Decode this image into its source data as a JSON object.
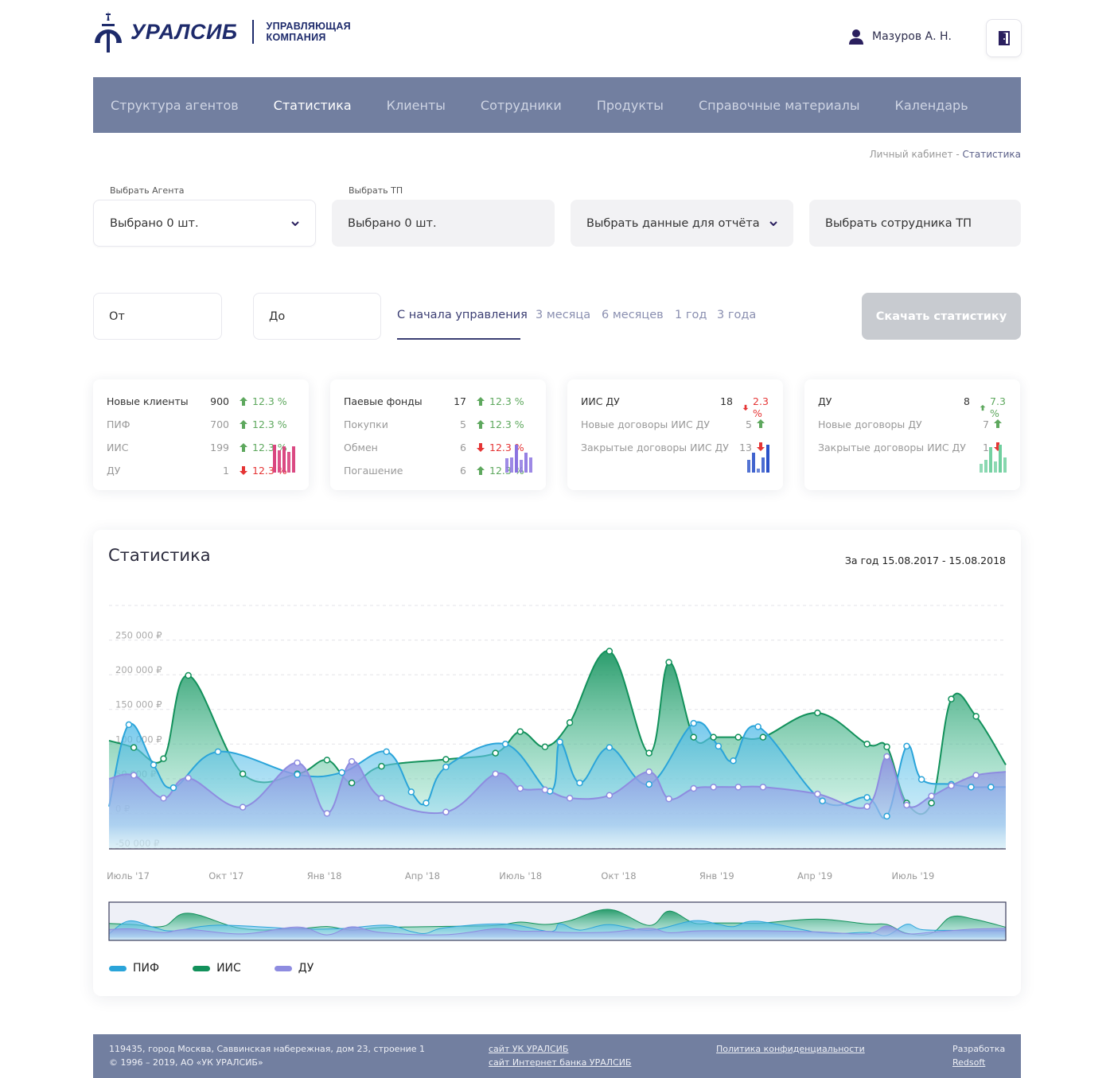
{
  "header": {
    "logo_name": "УРАЛСИБ",
    "logo_sub_line1": "УПРАВЛЯЮЩАЯ",
    "logo_sub_line2": "КОМПАНИЯ",
    "user_name": "Мазуров А. Н.",
    "user_icon": "user-icon",
    "logout_icon": "logout-door-icon",
    "brand_color": "#1d2a6b"
  },
  "nav": {
    "bg_color": "#727fa0",
    "items": [
      {
        "label": "Структура агентов"
      },
      {
        "label": "Статистика",
        "active": true
      },
      {
        "label": "Клиенты"
      },
      {
        "label": "Сотрудники"
      },
      {
        "label": "Продукты"
      },
      {
        "label": "Справочные материалы"
      },
      {
        "label": "Календарь"
      }
    ]
  },
  "breadcrumb": {
    "parent": "Личный кабинет",
    "separator": " - ",
    "current": "Статистика"
  },
  "filters": {
    "agent": {
      "label": "Выбрать Агента",
      "value": "Выбрано 0 шт."
    },
    "tp": {
      "label": "Выбрать ТП",
      "value": "Выбрано 0 шт."
    },
    "report": {
      "value": "Выбрать данные для отчёта"
    },
    "employee": {
      "value": "Выбрать сотрудника ТП"
    },
    "date_from": {
      "placeholder": "От"
    },
    "date_to": {
      "placeholder": "До"
    },
    "periods": [
      "С начала управления",
      "3 месяца",
      "6 месяцев",
      "1 год",
      "3 года"
    ],
    "active_period": 0,
    "download_label": "Скачать статистику"
  },
  "cards": [
    {
      "title": "Новые клиенты",
      "value": "900",
      "pct": "12.3 %",
      "dir": "up",
      "rows": [
        {
          "label": "ПИФ",
          "value": "700",
          "pct": "12.3 %",
          "dir": "up"
        },
        {
          "label": "ИИС",
          "value": "199",
          "pct": "12.3 %",
          "dir": "up"
        },
        {
          "label": "ДУ",
          "value": "1",
          "pct": "12.3 %",
          "dir": "down"
        }
      ],
      "bar_color": "#d9457f",
      "bars": [
        1.0,
        0.8,
        0.95,
        0.75,
        0.95
      ]
    },
    {
      "title": "Паевые фонды",
      "value": "17",
      "pct": "12.3 %",
      "dir": "up",
      "rows": [
        {
          "label": "Покупки",
          "value": "5",
          "pct": "12.3 %",
          "dir": "up"
        },
        {
          "label": "Обмен",
          "value": "6",
          "pct": "12.3 %",
          "dir": "down"
        },
        {
          "label": "Погашение",
          "value": "6",
          "pct": "12.3 %",
          "dir": "up"
        }
      ],
      "bar_color": "#8a72e0",
      "bars": [
        0.5,
        0.55,
        1.0,
        0.45,
        0.7,
        0.55
      ]
    },
    {
      "title": "ИИС ДУ",
      "value": "18",
      "pct": "2.3 %",
      "dir": "down",
      "rows": [
        {
          "label": "Новые договоры ИИС ДУ",
          "value": "5",
          "pct": "",
          "dir": "up"
        },
        {
          "label": "Закрытые договоры ИИС ДУ",
          "value": "13",
          "pct": "",
          "dir": "down"
        }
      ],
      "bar_color": "#2b52c9",
      "bars": [
        0.45,
        0.7,
        0.15,
        0.55,
        1.0
      ]
    },
    {
      "title": "ДУ",
      "value": "8",
      "pct": "7.3 %",
      "dir": "up",
      "rows": [
        {
          "label": "Новые договоры ДУ",
          "value": "7",
          "pct": "",
          "dir": "up"
        },
        {
          "label": "Закрытые договоры ИИС ДУ",
          "value": "1",
          "pct": "",
          "dir": "down"
        }
      ],
      "bar_color": "#6fcf9f",
      "bars": [
        0.3,
        0.45,
        0.9,
        0.4,
        1.0,
        0.55
      ]
    }
  ],
  "chart_data": {
    "type": "area",
    "title": "Статистика",
    "subtitle": "За год 15.08.2017 - 15.08.2018",
    "y_ticks": [
      "250 000 ₽",
      "200 000 ₽",
      "150 000 ₽",
      "100 000 ₽",
      "50 000 ₽",
      "0 ₽",
      "-50 000 ₽"
    ],
    "x_ticks": [
      "Июль '17",
      "Окт '17",
      "Янв '18",
      "Апр '18",
      "Июль '18",
      "Окт '18",
      "Янв '19",
      "Апр '19",
      "Июль '19"
    ],
    "ylim": [
      -50000,
      300000
    ],
    "grid": true,
    "legend_position": "bottom-left",
    "series": [
      {
        "name": "ПИФ",
        "color": "#2aa4d9",
        "x": [
          0,
          0.4,
          0.9,
          1.3,
          2.2,
          3.8,
          4.7,
          5.6,
          6.1,
          6.4,
          6.8,
          8.0,
          8.9,
          9.1,
          9.5,
          10.1,
          10.9,
          11.8,
          12.3,
          12.6,
          13.1,
          14.4,
          15.3,
          15.7,
          16.1,
          16.4,
          17.0,
          17.4,
          17.8,
          18.1
        ],
        "y": [
          10000,
          128000,
          70000,
          37000,
          89000,
          56000,
          59000,
          89000,
          31000,
          15000,
          67000,
          100000,
          32000,
          103000,
          44000,
          95000,
          42000,
          130000,
          97000,
          76000,
          125000,
          18000,
          23000,
          -4000,
          97000,
          49000,
          42000,
          38000,
          38000,
          38000
        ]
      },
      {
        "name": "ИИС",
        "color": "#12915b",
        "x": [
          0,
          0.5,
          1.1,
          1.6,
          2.7,
          3.8,
          4.4,
          4.9,
          5.5,
          6.8,
          7.8,
          8.3,
          8.8,
          9.3,
          10.1,
          10.9,
          11.3,
          11.8,
          12.2,
          12.7,
          13.2,
          14.3,
          15.3,
          15.7,
          16.1,
          16.6,
          17.0,
          17.5,
          18.1
        ],
        "y": [
          105000,
          95000,
          79000,
          199000,
          57000,
          57000,
          77000,
          44000,
          68000,
          78000,
          87000,
          118000,
          96000,
          131000,
          234000,
          87000,
          218000,
          110000,
          110000,
          110000,
          110000,
          145000,
          100000,
          96000,
          15000,
          15000,
          165000,
          140000,
          70000
        ]
      },
      {
        "name": "ДУ",
        "color": "#8e8ce0",
        "x": [
          0,
          0.5,
          1.1,
          1.6,
          2.7,
          3.8,
          4.4,
          4.9,
          5.5,
          6.8,
          7.8,
          8.3,
          8.8,
          9.3,
          10.1,
          10.9,
          11.3,
          11.8,
          12.2,
          12.7,
          13.2,
          14.3,
          15.3,
          15.7,
          16.1,
          16.6,
          17.0,
          17.5,
          18.1
        ],
        "y": [
          50000,
          55000,
          22000,
          51000,
          9000,
          73000,
          0,
          75000,
          22000,
          2000,
          57000,
          36000,
          34000,
          22000,
          26000,
          60000,
          21000,
          36000,
          38000,
          38000,
          38000,
          28000,
          10000,
          82000,
          12000,
          25000,
          40000,
          55000,
          60000
        ]
      }
    ]
  },
  "footer": {
    "address": "119435, город Москва, Саввинская набережная, дом 23, строение 1",
    "copyright": "© 1996 – 2019, АО «УК УРАЛСИБ»",
    "link_site": "сайт УК УРАЛСИБ",
    "link_bank": "сайт Интернет банка УРАЛСИБ",
    "link_policy": "Политика конфиденциальности",
    "dev_label": "Разработка",
    "dev_link": "Redsoft"
  }
}
